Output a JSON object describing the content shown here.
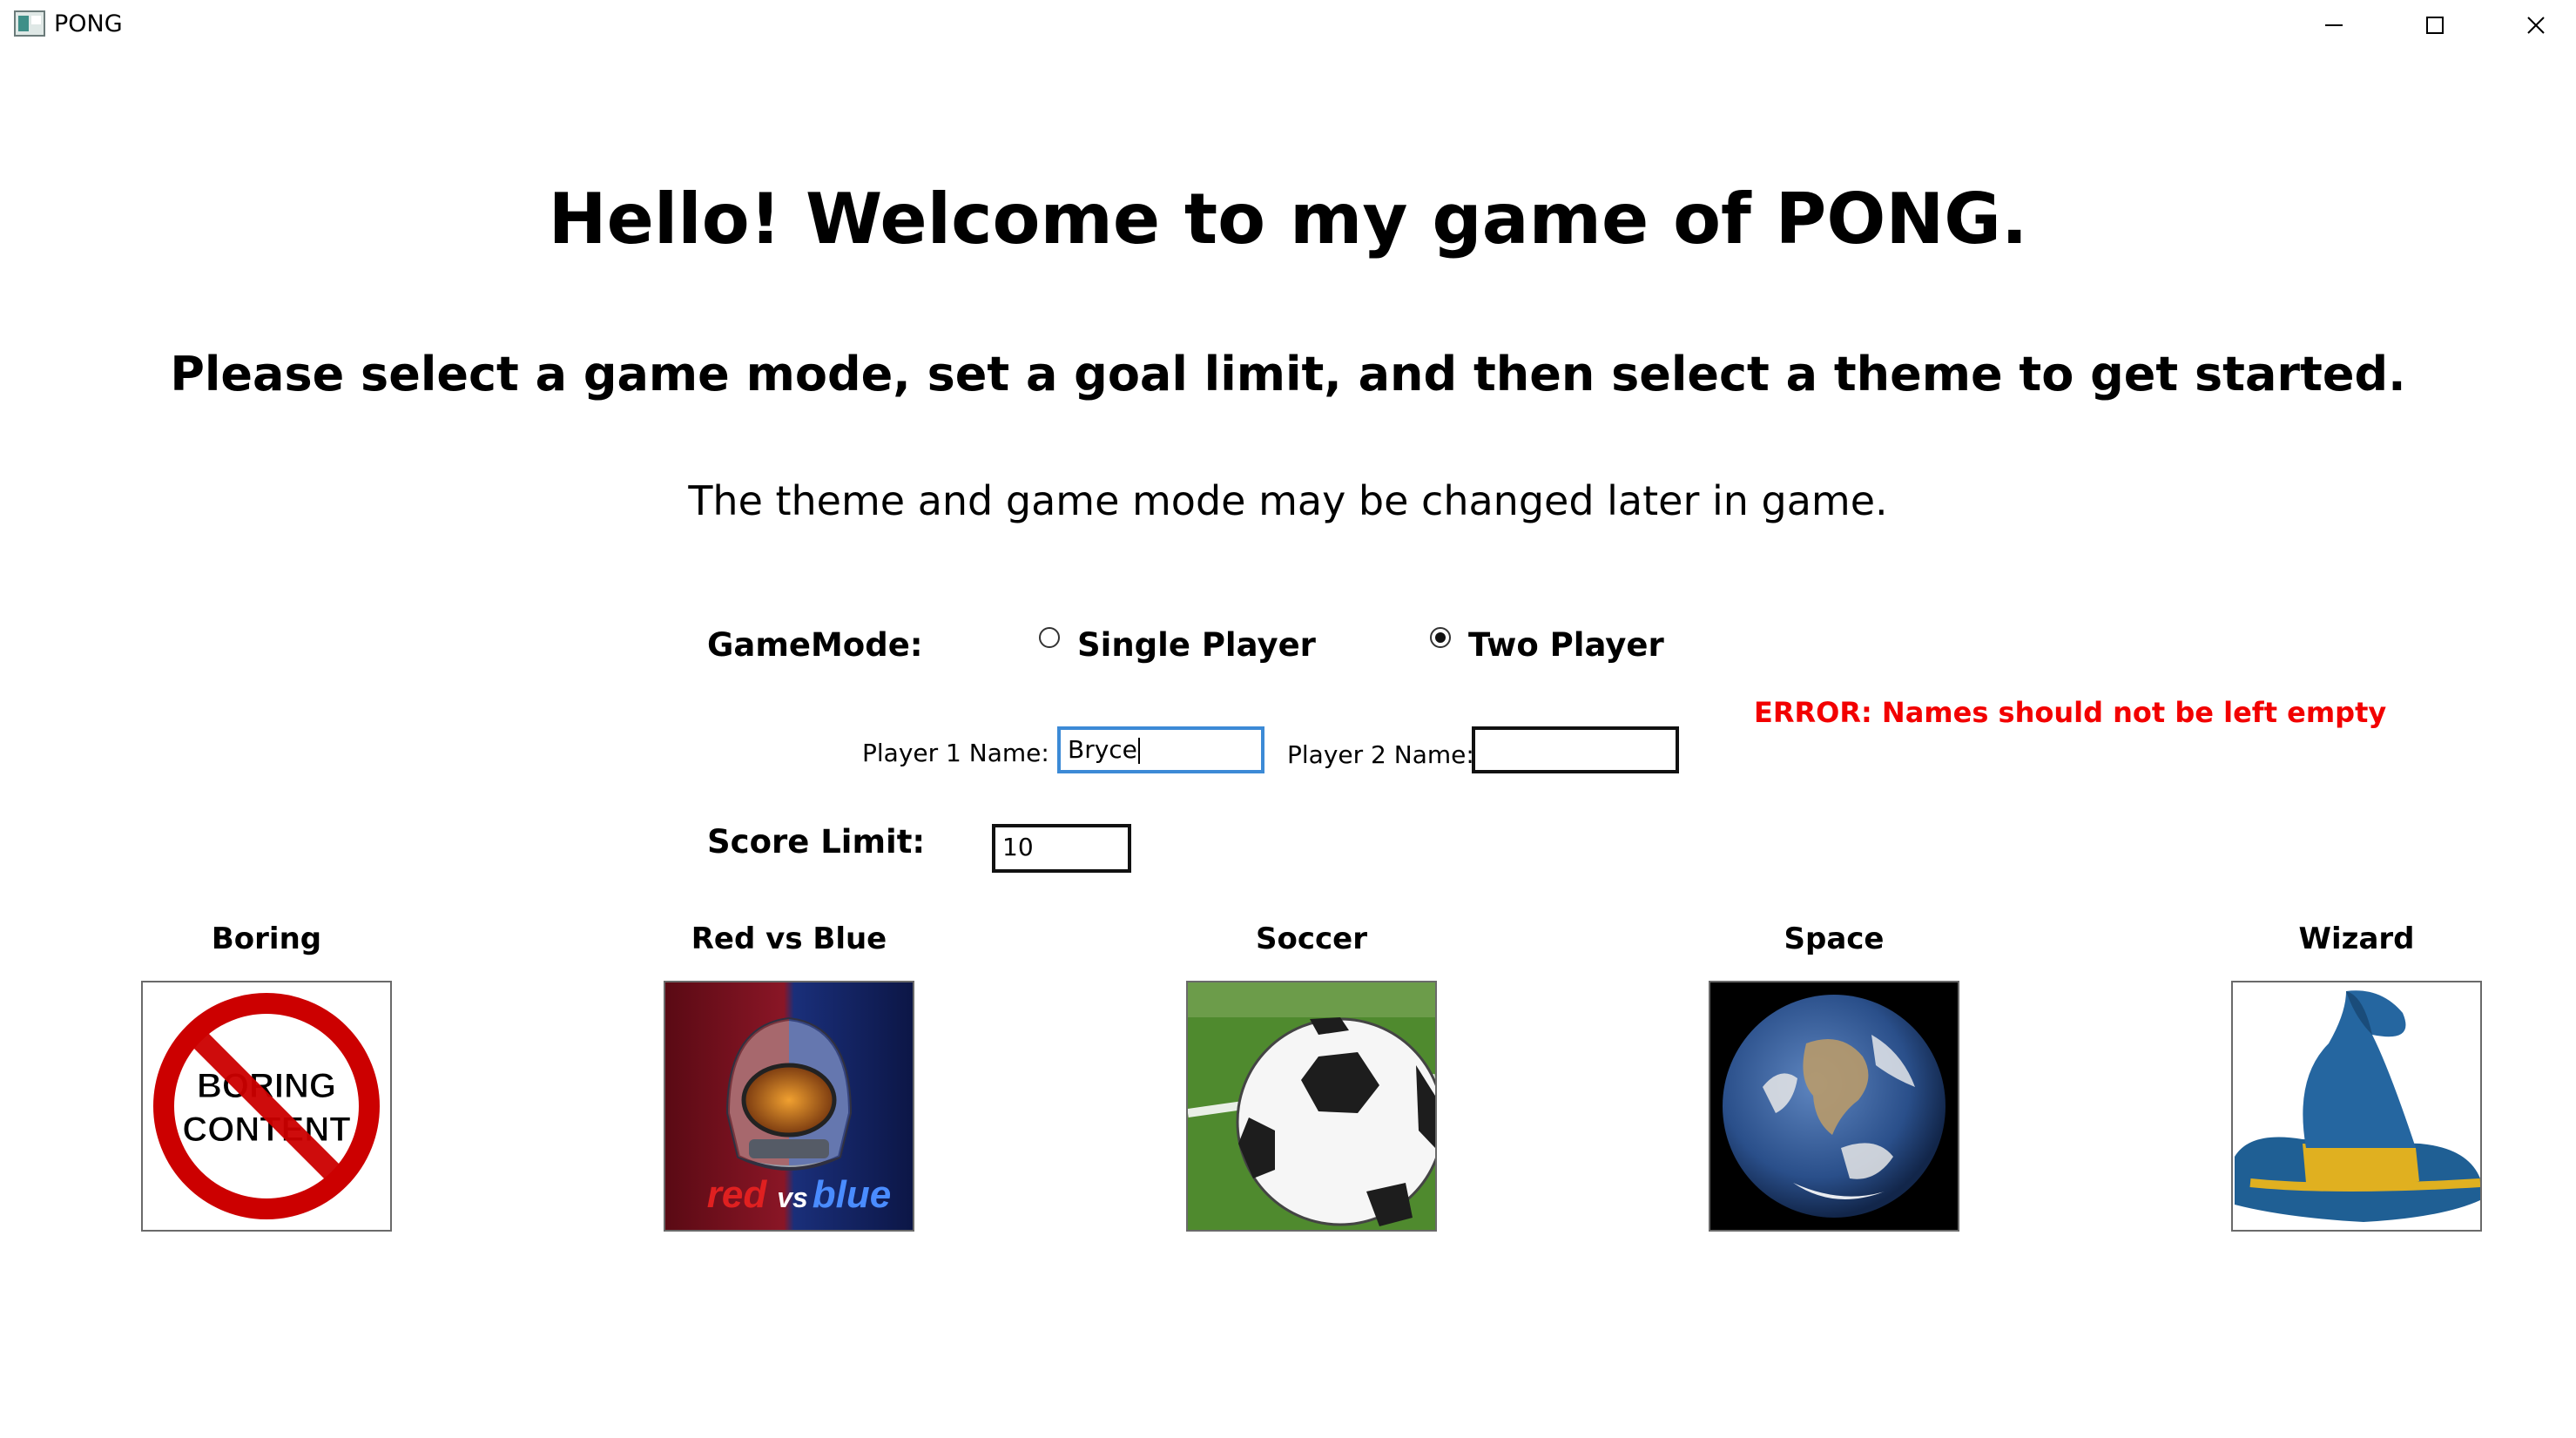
{
  "window": {
    "title": "PONG",
    "controls": {
      "minimize": "minimize-icon",
      "maximize": "maximize-icon",
      "close": "close-icon"
    }
  },
  "headings": {
    "welcome": "Hello! Welcome to my game of PONG.",
    "instructions": "Please select a game mode, set a goal limit, and then select a theme to get started.",
    "note": "The theme and game mode may be changed later in game."
  },
  "game_mode": {
    "label": "GameMode:",
    "options": [
      {
        "label": "Single Player",
        "selected": false
      },
      {
        "label": "Two Player",
        "selected": true
      }
    ]
  },
  "players": {
    "player1_label": "Player 1 Name:",
    "player1_value": "Bryce",
    "player2_label": "Player 2 Name:",
    "player2_value": ""
  },
  "error": "ERROR: Names should not be left empty",
  "score_limit": {
    "label": "Score Limit:",
    "value": "10"
  },
  "themes": [
    {
      "label": "Boring",
      "icon": "boring-content-icon",
      "image_text": [
        "BORING",
        "CONTENT"
      ]
    },
    {
      "label": "Red vs Blue",
      "icon": "red-vs-blue-icon",
      "image_text": [
        "red",
        "vs",
        "blue"
      ]
    },
    {
      "label": "Soccer",
      "icon": "soccer-ball-icon"
    },
    {
      "label": "Space",
      "icon": "earth-icon"
    },
    {
      "label": "Wizard",
      "icon": "wizard-hat-icon"
    }
  ],
  "colors": {
    "error": "#f20000",
    "focus_border": "#3c8ad6"
  }
}
